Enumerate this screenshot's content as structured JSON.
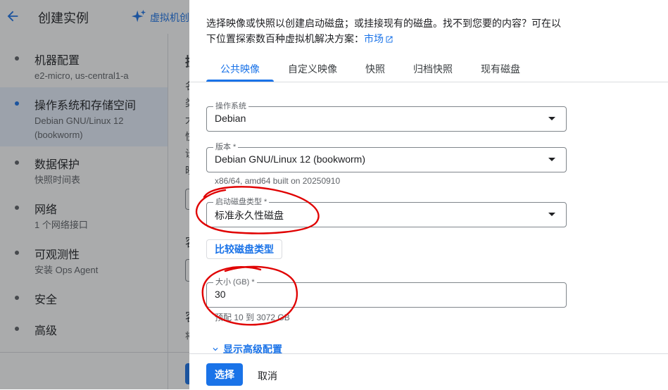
{
  "header": {
    "title": "创建实例",
    "vm_link": "虚拟机创"
  },
  "nav": {
    "items": [
      {
        "title": "机器配置",
        "sub": "e2-micro, us-central1-a"
      },
      {
        "title": "操作系统和存储空间",
        "sub": "Debian GNU/Linux 12",
        "sub2": "(bookworm)"
      },
      {
        "title": "数据保护",
        "sub": "快照时间表"
      },
      {
        "title": "网络",
        "sub": "1 个网络接口"
      },
      {
        "title": "可观测性",
        "sub": "安装 Ops Agent"
      },
      {
        "title": "安全"
      },
      {
        "title": "高级"
      }
    ]
  },
  "background": {
    "frag_a": "操",
    "frag_b": "名",
    "frag_c": "类",
    "frag_d": "大",
    "frag_e": "快",
    "frag_f": "设",
    "frag_g": "映",
    "frag_h": "容",
    "frag_i": "容",
    "frag_j": "将"
  },
  "panel": {
    "intro_line1": "选择映像或快照以创建启动磁盘；或挂接现有的磁盘。找不到您要的内容？可在以",
    "intro_line2": "下位置探索数百种虚拟机解决方案：",
    "marketplace_link": "市场",
    "tabs": [
      {
        "label": "公共映像",
        "active": true
      },
      {
        "label": "自定义映像"
      },
      {
        "label": "快照"
      },
      {
        "label": "归档快照"
      },
      {
        "label": "现有磁盘"
      }
    ],
    "os_field": {
      "label": "操作系统",
      "value": "Debian"
    },
    "version_field": {
      "label": "版本 *",
      "value": "Debian GNU/Linux 12 (bookworm)",
      "helper": "x86/64, amd64 built on 20250910"
    },
    "disk_type_field": {
      "label": "启动磁盘类型 *",
      "value": "标准永久性磁盘"
    },
    "compare_button": "比较磁盘类型",
    "size_field": {
      "label": "大小 (GB) *",
      "value": "30",
      "helper": "预配 10 到 3072 GB"
    },
    "advanced_toggle": "显示高级配置",
    "select_button": "选择",
    "cancel_button": "取消"
  },
  "colors": {
    "accent": "#1a73e8",
    "annotation": "#e00000",
    "scrim": "rgba(32,33,36,0.38)"
  },
  "icons": [
    "back-arrow-icon",
    "sparkle-icon",
    "external-link-icon",
    "chevron-down-icon",
    "dropdown-caret-icon"
  ]
}
